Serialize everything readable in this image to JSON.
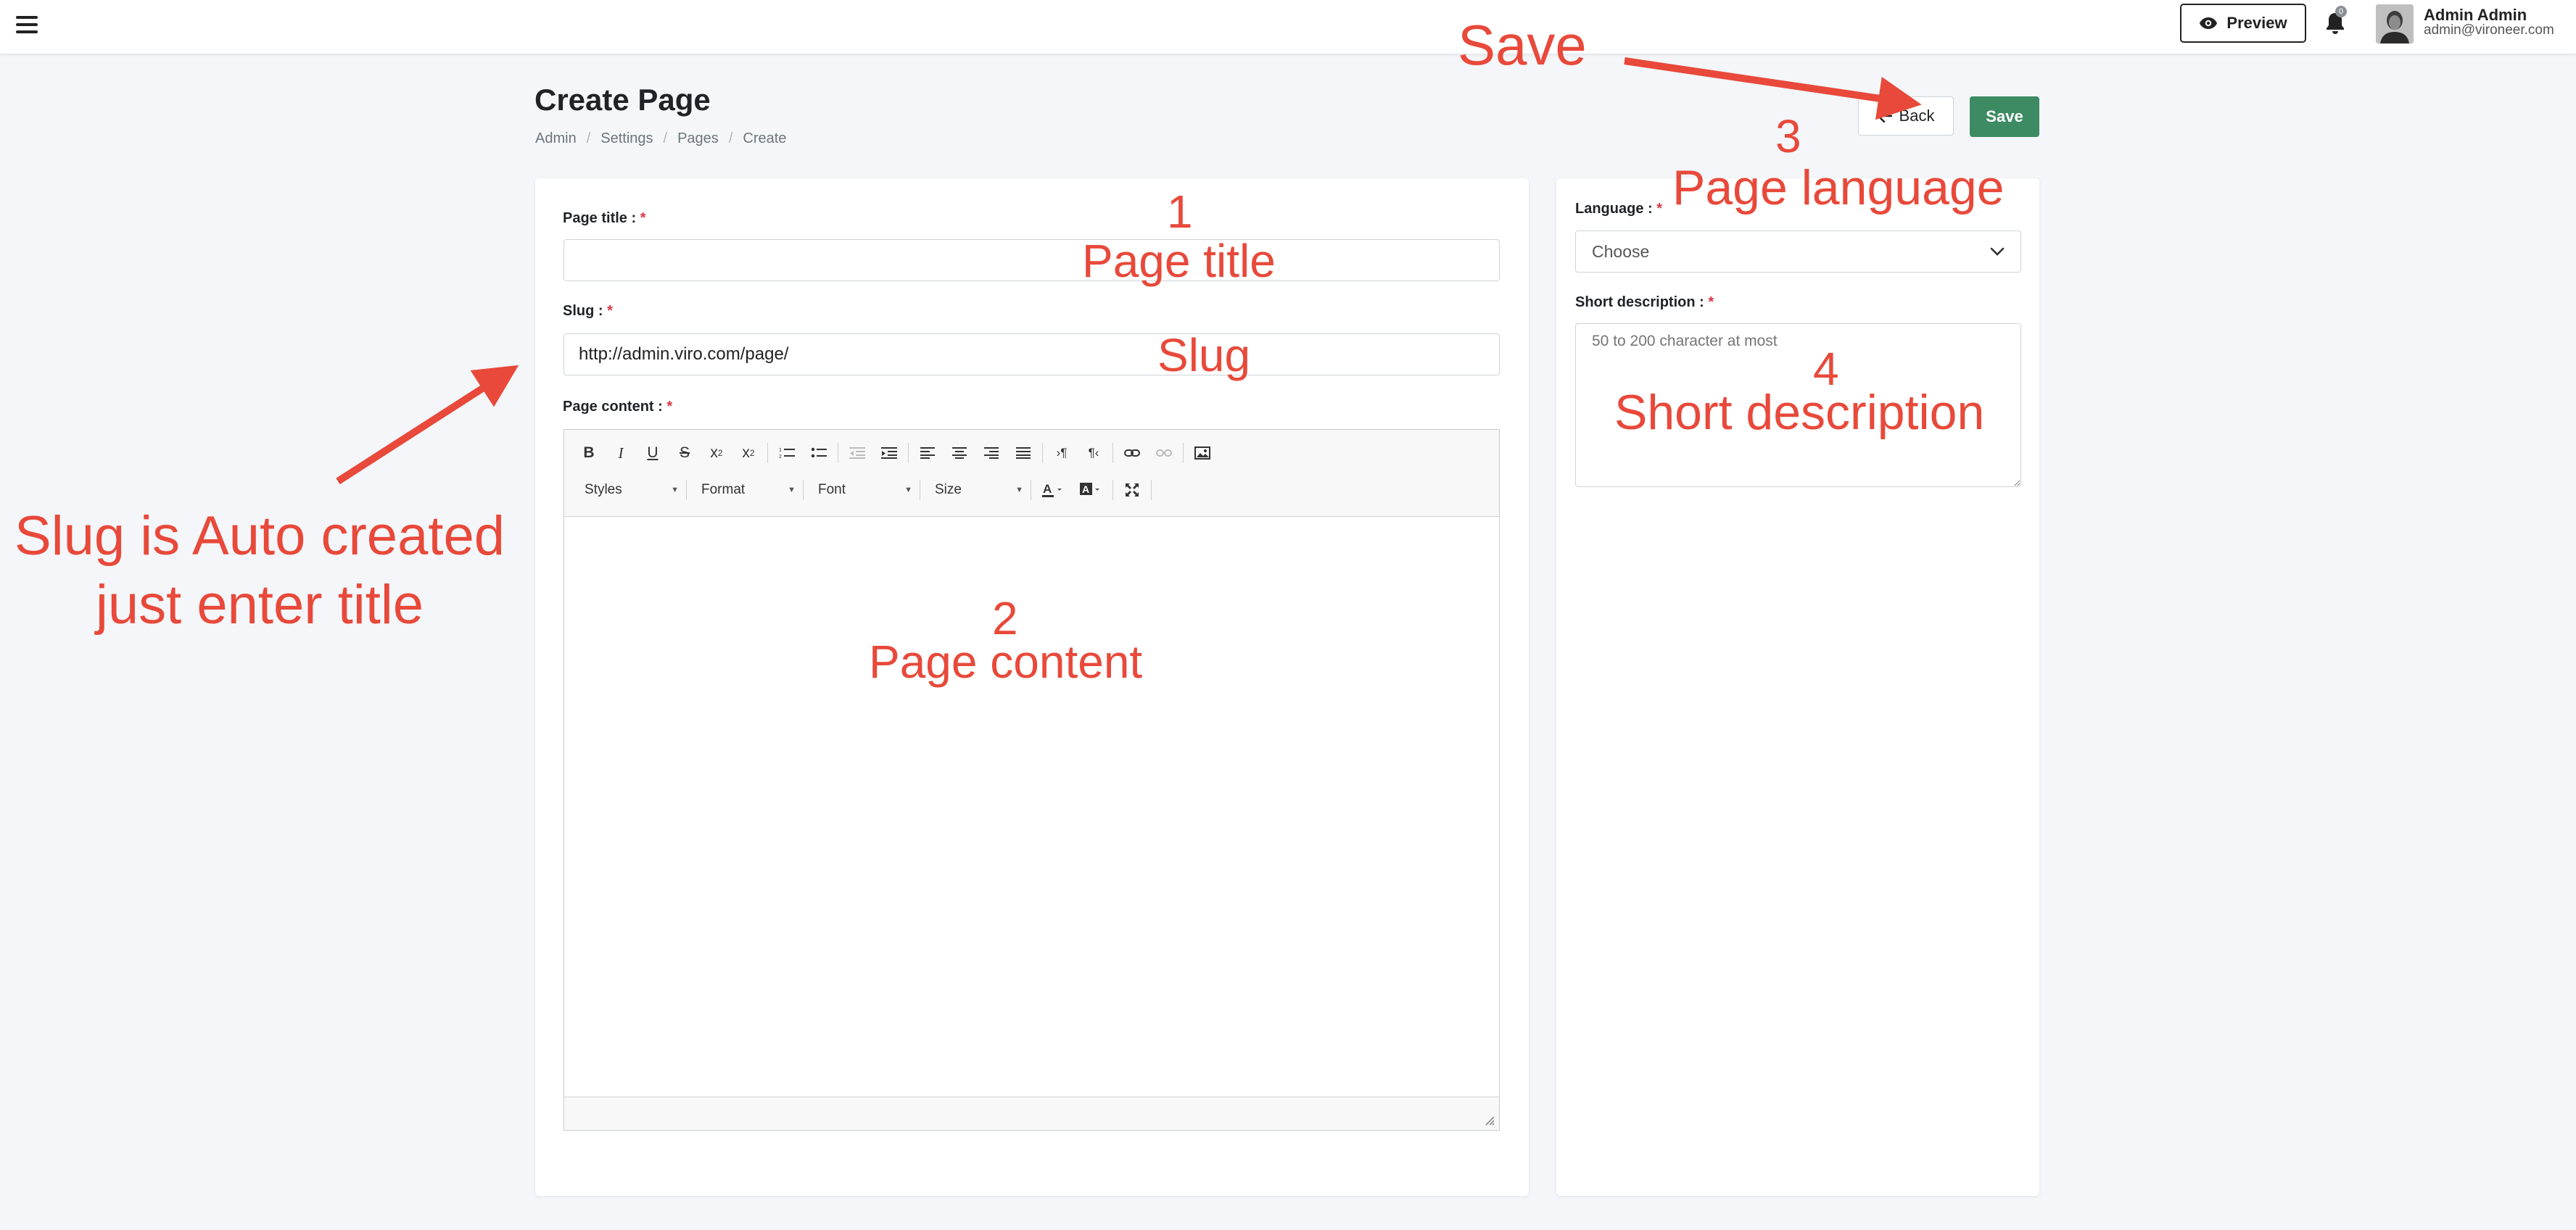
{
  "topbar": {
    "preview_label": "Preview",
    "notification_count": "0",
    "user_name": "Admin Admin",
    "user_email": "admin@vironeer.com"
  },
  "header": {
    "title": "Create Page",
    "breadcrumb": [
      "Admin",
      "Settings",
      "Pages",
      "Create"
    ],
    "back_label": "Back",
    "save_label": "Save"
  },
  "form": {
    "page_title": {
      "label": "Page title :",
      "required": "*",
      "value": ""
    },
    "slug": {
      "label": "Slug :",
      "required": "*",
      "value": "http://admin.viro.com/page/"
    },
    "page_content": {
      "label": "Page content :",
      "required": "*"
    },
    "editor": {
      "combos": [
        "Styles",
        "Format",
        "Font",
        "Size"
      ]
    }
  },
  "sidebar": {
    "language": {
      "label": "Language :",
      "required": "*",
      "selected": "Choose"
    },
    "short_description": {
      "label": "Short description :",
      "required": "*",
      "placeholder": "50 to 200 character at most"
    }
  },
  "annotations": {
    "save": "Save",
    "n1": "1",
    "t1": "Page title",
    "slug": "Slug",
    "n2": "2",
    "t2": "Page content",
    "n3": "3",
    "t3": "Page language",
    "n4": "4",
    "t4": "Short description",
    "slug_note": "Slug is Auto created just enter title"
  },
  "colors": {
    "annotation": "#e8493a",
    "save_button": "#3d8b63",
    "background": "#f4f6f9"
  }
}
